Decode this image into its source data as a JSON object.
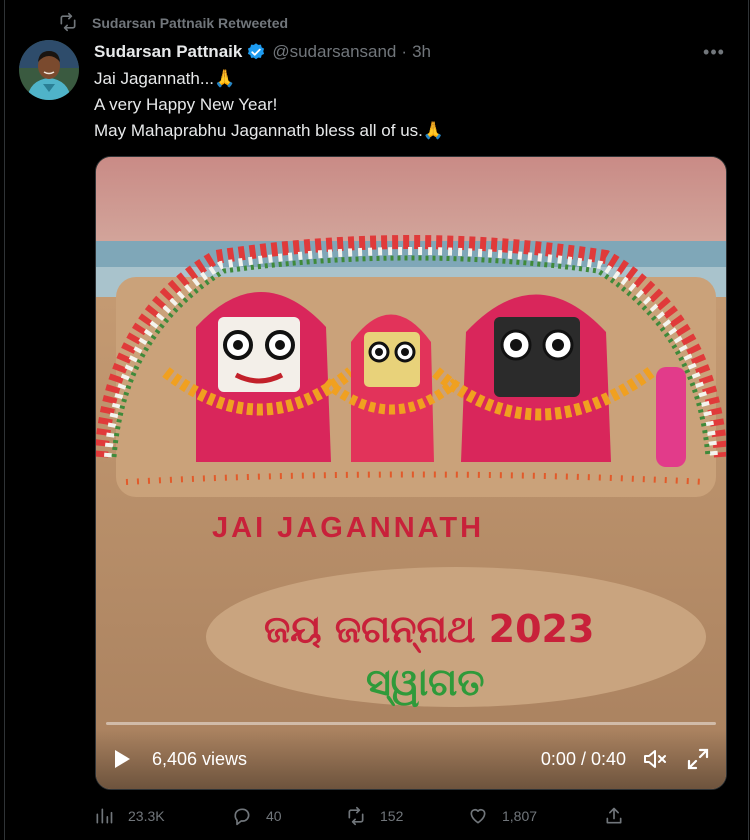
{
  "retweet": {
    "label": "Sudarsan Pattnaik Retweeted",
    "icon": "retweet-icon"
  },
  "author": {
    "name": "Sudarsan Pattnaik",
    "handle": "@sudarsansand",
    "separator": "·",
    "time": "3h",
    "verified_icon": "verified-badge-icon",
    "verified_color": "#1d9bf0"
  },
  "more_label": "•••",
  "tweet": {
    "lines": [
      "Jai Jagannath...🙏",
      "A very Happy New Year!",
      "May Mahaprabhu Jagannath bless all of us.🙏"
    ]
  },
  "media": {
    "artwork_text_english": "JAI JAGANNATH",
    "artwork_text_odia_line1": "ଜୟ ଜଗନ୍ନାଥ 2023",
    "artwork_text_odia_line2": "ସ୍ୱାଗତ",
    "views": "6,406 views",
    "timecode": "0:00 / 0:40",
    "progress": 0,
    "icons": [
      "play-icon",
      "volume-icon",
      "fullscreen-icon"
    ]
  },
  "actions": {
    "analytics": {
      "count": "23.3K",
      "icon": "analytics-icon"
    },
    "reply": {
      "count": "40",
      "icon": "reply-icon"
    },
    "retweet": {
      "count": "152",
      "icon": "retweet-icon"
    },
    "like": {
      "count": "1,807",
      "icon": "like-icon"
    },
    "share": {
      "icon": "share-icon"
    }
  },
  "colors": {
    "background": "#000000",
    "text": "#e7e9ea",
    "muted": "#71767b",
    "accent": "#1d9bf0"
  }
}
